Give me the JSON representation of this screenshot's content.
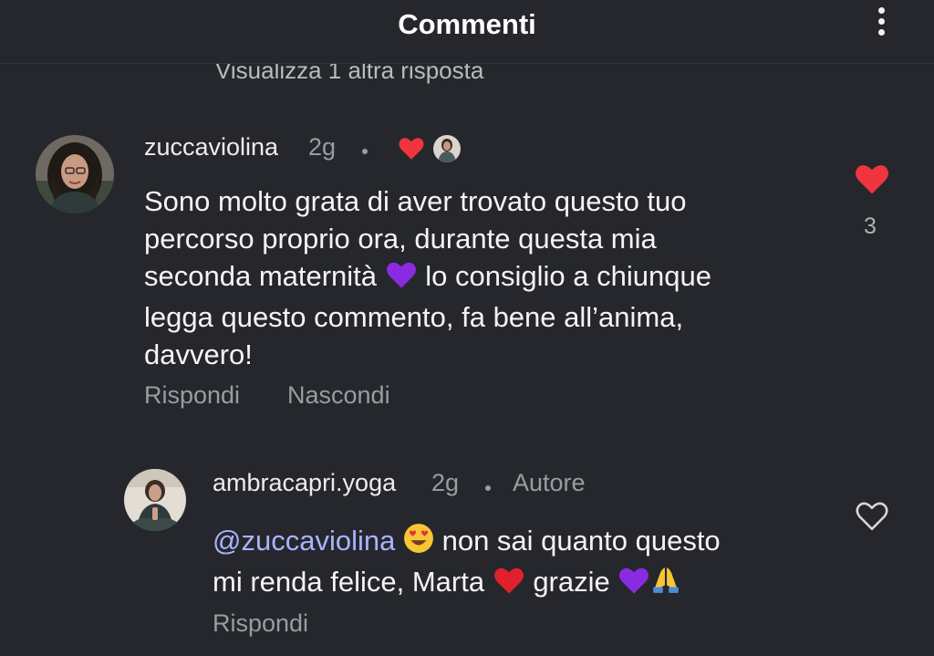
{
  "header": {
    "title": "Commenti"
  },
  "cut_reply_text": "Visualizza 1 altra risposta",
  "comment": {
    "username": "zuccaviolina",
    "time": "2g",
    "line1": "Sono molto grata di aver trovato questo tuo",
    "line2": "percorso proprio ora, durante questa mia",
    "line3a": "seconda maternità",
    "line3b": "lo consiglio a chiunque",
    "line4": "legga questo commento, fa bene all’anima,",
    "line5": "davvero!",
    "reply_label": "Rispondi",
    "hide_label": "Nascondi",
    "like_count": "3",
    "liked": true
  },
  "reply": {
    "username": "ambracapri.yoga",
    "time": "2g",
    "badge": "Autore",
    "mention": "@zuccaviolina",
    "text1": "non sai quanto questo",
    "text2a": "mi renda felice, Marta",
    "text2b": "grazie",
    "reply_label": "Rispondi",
    "liked": false
  },
  "colors": {
    "background": "#25272c",
    "heart_red": "#f0353f",
    "mention": "#a9b3ff",
    "purple_heart": "#8a2be2"
  }
}
